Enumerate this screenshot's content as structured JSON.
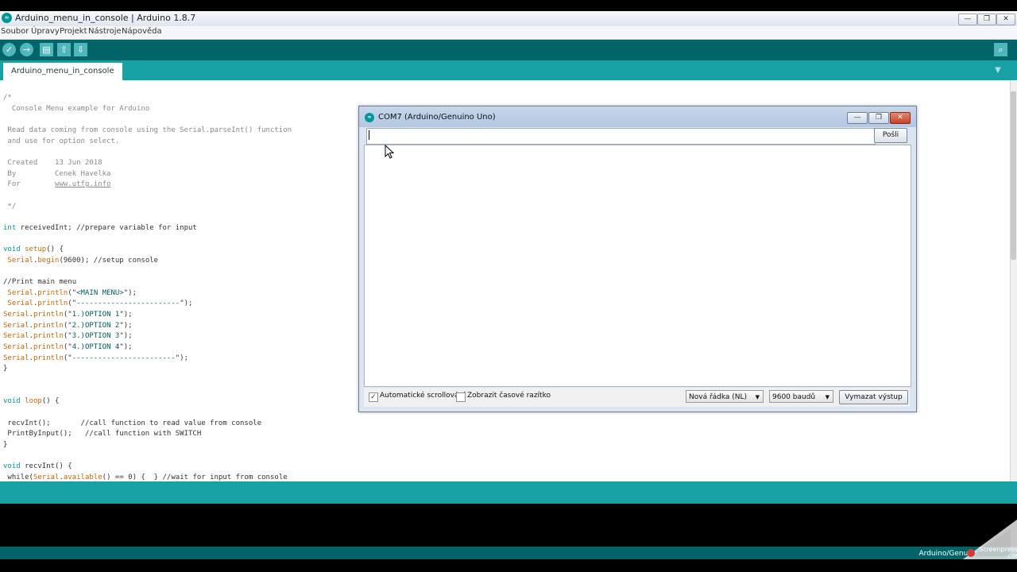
{
  "window": {
    "title": "Arduino_menu_in_console | Arduino 1.8.7",
    "logo_text": "∞",
    "minimize": "—",
    "restore": "❐",
    "close": "✕"
  },
  "menu": {
    "items": [
      "Soubor",
      "Úpravy",
      "Projekt",
      "Nástroje",
      "Nápověda"
    ]
  },
  "toolbar": {
    "verify_icon": "check-icon",
    "upload_icon": "arrow-right-icon",
    "new_icon": "new-file-icon",
    "open_icon": "open-icon",
    "save_icon": "save-icon",
    "serial_monitor_icon": "magnifier-icon"
  },
  "tabs": {
    "active": "Arduino_menu_in_console",
    "menu_arrow": "▼"
  },
  "code_lines": [
    "/*",
    "  Console Menu example for Arduino",
    "",
    " Read data coming from console using the Serial.parseInt() function",
    " and use for option select.",
    "",
    " Created    13 Jun 2018",
    " By         Cenek Havelka",
    " For        www.utfg.info",
    "",
    " */",
    "",
    "int receivedInt; //prepare variable for input",
    "",
    "void setup() {",
    " Serial.begin(9600); //setup console",
    "",
    "//Print main menu",
    " Serial.println(\"<MAIN MENU>\");",
    " Serial.println(\"------------------------\");",
    "Serial.println(\"1.)OPTION 1\");",
    "Serial.println(\"2.)OPTION 2\");",
    "Serial.println(\"3.)OPTION 3\");",
    "Serial.println(\"4.)OPTION 4\");",
    "Serial.println(\"------------------------\");",
    "}",
    "",
    "",
    "void loop() {",
    "",
    " recvInt();       //call function to read value from console",
    " PrintByInput();   //call function with SWITCH",
    "}",
    "",
    "void recvInt() {",
    " while(Serial.available() == 0) {  } //wait for input from console"
  ],
  "status": {
    "board": "Arduino/Genuino"
  },
  "watermark": {
    "line1": "Screenpresso",
    "line2": ".com"
  },
  "serial_monitor": {
    "title": "COM7 (Arduino/Genuino Uno)",
    "input_value": "",
    "send_label": "Pošli",
    "autoscroll_label": "Automatické scrollování",
    "autoscroll_checked": true,
    "timestamp_label": "Zobrazit časové razítko",
    "timestamp_checked": false,
    "line_ending": "Nová řádka (NL)",
    "baud": "9600 baudů",
    "clear_label": "Vymazat výstup"
  }
}
